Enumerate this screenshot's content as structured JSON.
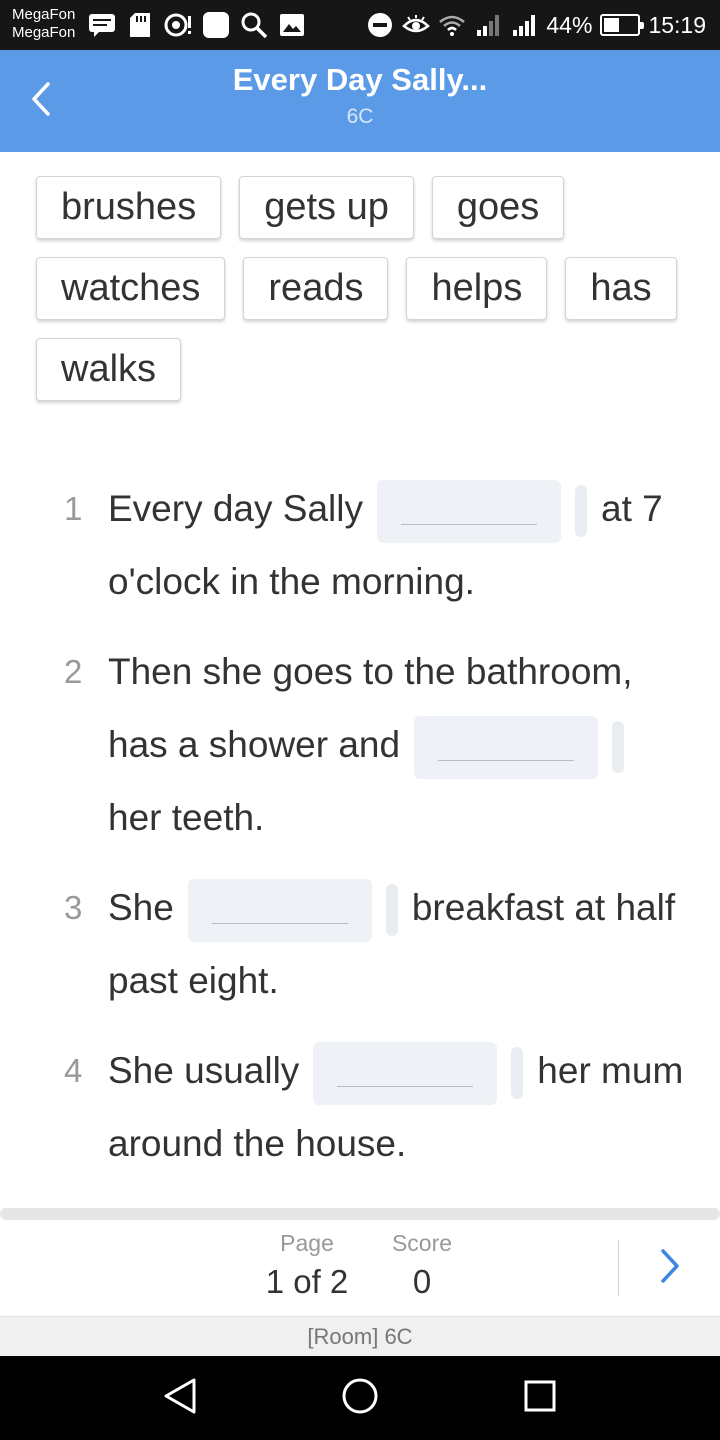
{
  "status_bar": {
    "carrier_1": "MegaFon",
    "carrier_2": "MegaFon",
    "battery": "44%",
    "battery_level": 0.44,
    "time": "15:19",
    "icons": [
      "message-icon",
      "sd-card-icon",
      "sync-icon",
      "app-icon",
      "search-icon",
      "gallery-icon",
      "do-not-disturb-icon",
      "eye-icon",
      "wifi-icon",
      "signal-icon",
      "signal-icon-2"
    ]
  },
  "header": {
    "title": "Every Day Sally...",
    "subtitle": "6C",
    "back_icon": "chevron-left-icon",
    "color": "#5a9ae6"
  },
  "word_bank": [
    "brushes",
    "gets up",
    "goes",
    "watches",
    "reads",
    "helps",
    "has",
    "walks"
  ],
  "questions": [
    {
      "num": "1",
      "before": "Every day Sally",
      "after": "at 7 o'clock in the morning."
    },
    {
      "num": "2",
      "before": "Then she goes to the bathroom, has a shower and",
      "after": "her teeth."
    },
    {
      "num": "3",
      "before": "She",
      "after": "breakfast at half past eight."
    },
    {
      "num": "4",
      "before": "She usually",
      "after": "her mum around the house."
    }
  ],
  "footer": {
    "page_label": "Page",
    "page_value": "1 of 2",
    "score_label": "Score",
    "score_value": "0",
    "next_icon": "chevron-right-icon",
    "room": "[Room] 6C"
  },
  "nav": [
    "back-triangle-icon",
    "home-circle-icon",
    "recents-square-icon"
  ]
}
